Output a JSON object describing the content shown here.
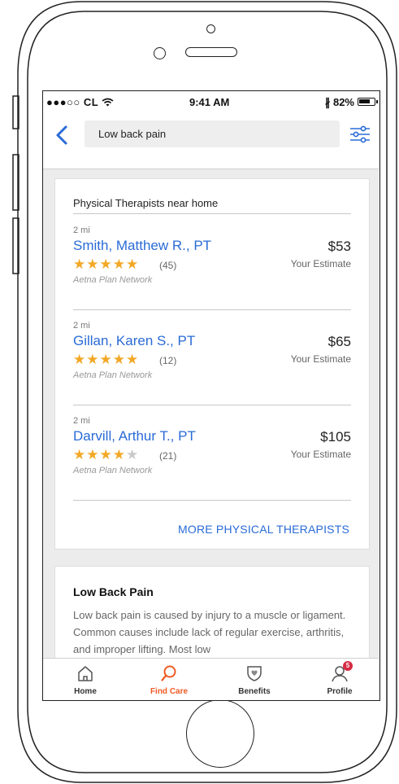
{
  "status_bar": {
    "carrier": "●●●○○ CL",
    "time": "9:41 AM",
    "battery": "82%",
    "battery_level": 0.82
  },
  "search": {
    "value": "Low back pain"
  },
  "therapists_card": {
    "title": "Physical Therapists near home",
    "providers": [
      {
        "distance": "2 mi",
        "name": "Smith, Matthew R., PT",
        "rating": 5,
        "review_count": "(45)",
        "network": "Aetna Plan Network",
        "price": "$53",
        "price_label": "Your Estimate"
      },
      {
        "distance": "2 mi",
        "name": "Gillan, Karen S., PT",
        "rating": 5,
        "review_count": "(12)",
        "network": "Aetna Plan Network",
        "price": "$65",
        "price_label": "Your Estimate"
      },
      {
        "distance": "2 mi",
        "name": "Darvill, Arthur T., PT",
        "rating": 4,
        "review_count": "(21)",
        "network": "Aetna Plan Network",
        "price": "$105",
        "price_label": "Your Estimate"
      }
    ],
    "more_label": "MORE PHYSICAL THERAPISTS"
  },
  "info_card": {
    "title": "Low Back Pain",
    "text": "Low back pain is caused by injury to a muscle or ligament. Common causes include lack of regular exercise, arthritis, and improper lifting. Most low"
  },
  "tab_bar": {
    "tabs": [
      {
        "label": "Home",
        "icon": "home-icon"
      },
      {
        "label": "Find Care",
        "icon": "search-icon"
      },
      {
        "label": "Benefits",
        "icon": "shield-icon"
      },
      {
        "label": "Profile",
        "icon": "profile-icon"
      }
    ],
    "active": "Find Care",
    "profile_badge": "5"
  },
  "colors": {
    "link": "#2a6bd6",
    "star": "#f2a826",
    "active_tab": "#ee5a24",
    "badge": "#d62b43"
  }
}
